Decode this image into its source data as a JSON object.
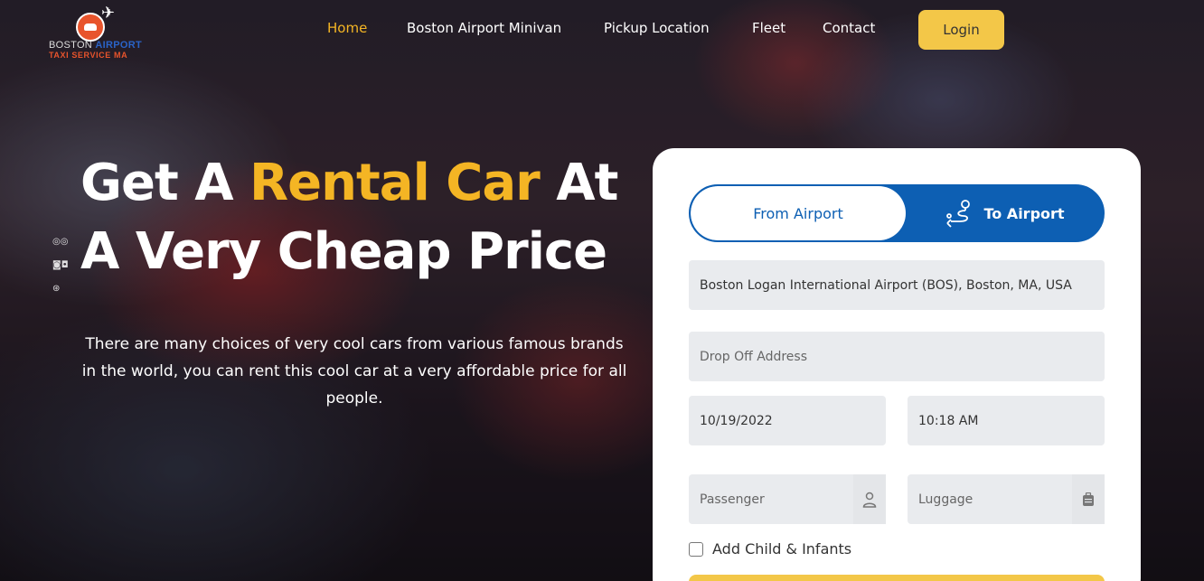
{
  "logo": {
    "line1_a": "BOSTON ",
    "line1_b": "AIRPORT",
    "line2": "TAXI SERVICE MA"
  },
  "nav": {
    "items": [
      {
        "label": "Home",
        "active": true
      },
      {
        "label": "Boston Airport Minivan",
        "active": false
      },
      {
        "label": "Pickup Location",
        "active": false
      },
      {
        "label": "Fleet",
        "active": false
      },
      {
        "label": "Contact",
        "active": false
      }
    ],
    "login_label": "Login"
  },
  "hero": {
    "headline_part1": "Get A ",
    "headline_highlight": "Rental Car",
    "headline_part2": " At",
    "headline_line2": "A Very Cheap Price",
    "subtext": "There are many choices of very cool cars from various famous brands in the world, you can rent this cool car at a very affordable price for all people."
  },
  "booking": {
    "tab_from": "From Airport",
    "tab_to": "To Airport",
    "pickup_value": "Boston Logan International Airport (BOS), Boston, MA, USA",
    "dropoff_placeholder": "Drop Off Address",
    "date_value": "10/19/2022",
    "time_value": "10:18 AM",
    "passenger_placeholder": "Passenger",
    "luggage_placeholder": "Luggage",
    "child_label": "Add Child & Infants"
  },
  "colors": {
    "accent": "#f4b524",
    "primary": "#0d5fb3",
    "button": "#f3c748"
  }
}
